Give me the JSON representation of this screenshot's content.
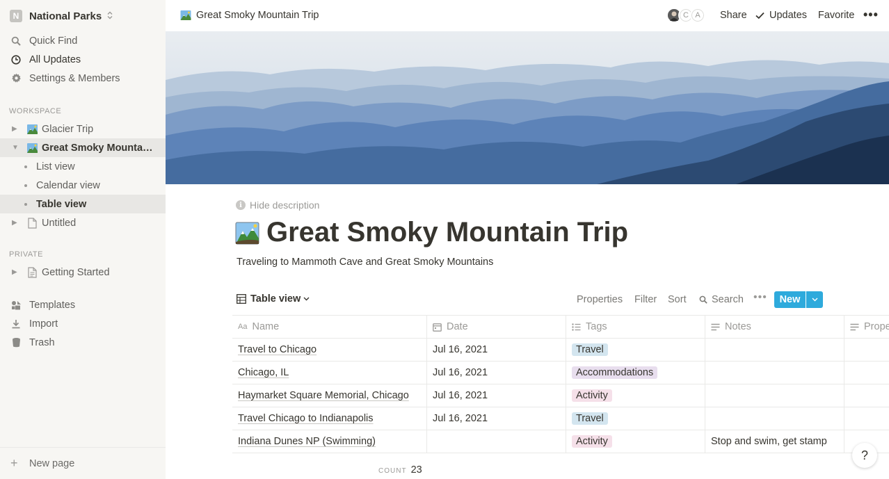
{
  "workspace": {
    "badge": "N",
    "name": "National Parks"
  },
  "sidebar": {
    "nav": [
      {
        "label": "Quick Find",
        "icon": "search-icon"
      },
      {
        "label": "All Updates",
        "icon": "clock-icon"
      },
      {
        "label": "Settings & Members",
        "icon": "gear-icon"
      }
    ],
    "workspace_label": "WORKSPACE",
    "tree": {
      "glacier": "Glacier Trip",
      "smoky": "Great Smoky Mountai…",
      "views": [
        "List view",
        "Calendar view",
        "Table view"
      ],
      "untitled": "Untitled"
    },
    "private_label": "PRIVATE",
    "getting_started": "Getting Started",
    "tools": [
      {
        "label": "Templates",
        "icon": "templates-icon"
      },
      {
        "label": "Import",
        "icon": "import-icon"
      },
      {
        "label": "Trash",
        "icon": "trash-icon"
      }
    ],
    "new_page": "New page"
  },
  "topbar": {
    "breadcrumb": "Great Smoky Mountain Trip",
    "avatars": [
      "C",
      "A"
    ],
    "share": "Share",
    "updates": "Updates",
    "favorite": "Favorite"
  },
  "page": {
    "hide_description": "Hide description",
    "title": "Great Smoky Mountain Trip",
    "description": "Traveling to Mammoth Cave and Great Smoky Mountains"
  },
  "view": {
    "current": "Table view",
    "properties": "Properties",
    "filter": "Filter",
    "sort": "Sort",
    "search": "Search",
    "new": "New"
  },
  "table": {
    "columns": [
      "Name",
      "Date",
      "Tags",
      "Notes",
      "Prope"
    ],
    "rows": [
      {
        "name": "Travel to Chicago",
        "date": "Jul 16, 2021",
        "tag": "Travel",
        "tag_color": "#d3e5ef",
        "notes": ""
      },
      {
        "name": "Chicago, IL",
        "date": "Jul 16, 2021",
        "tag": "Accommodations",
        "tag_color": "#e8deee",
        "notes": ""
      },
      {
        "name": "Haymarket Square Memorial, Chicago",
        "date": "Jul 16, 2021",
        "tag": "Activity",
        "tag_color": "#f5e0e9",
        "notes": ""
      },
      {
        "name": "Travel Chicago to Indianapolis",
        "date": "Jul 16, 2021",
        "tag": "Travel",
        "tag_color": "#d3e5ef",
        "notes": ""
      },
      {
        "name": "Indiana Dunes NP (Swimming)",
        "date": "",
        "tag": "Activity",
        "tag_color": "#f5e0e9",
        "notes": "Stop and swim, get stamp"
      }
    ],
    "count_label": "COUNT",
    "count": "23"
  },
  "help": "?"
}
